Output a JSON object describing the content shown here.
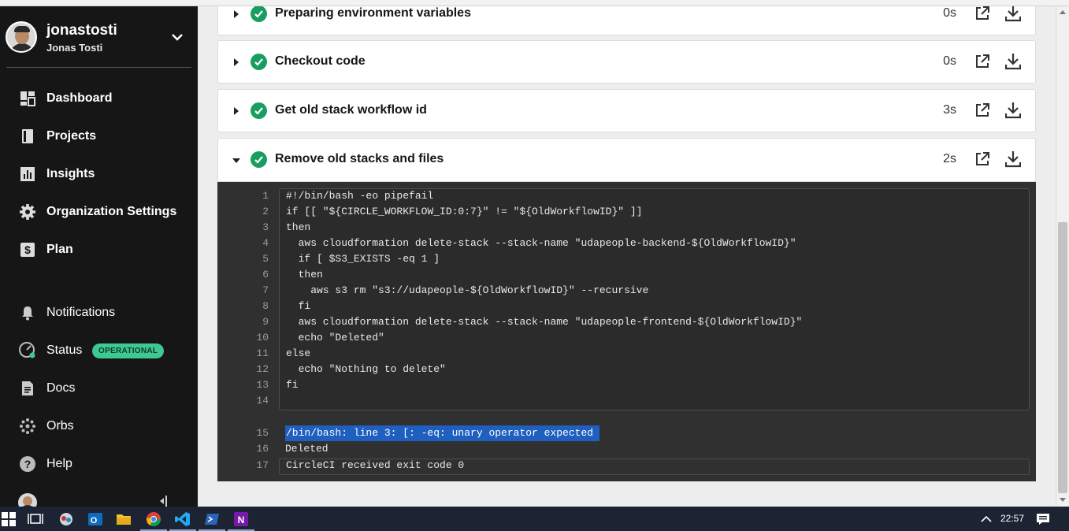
{
  "user": {
    "username": "jonastosti",
    "full_name": "Jonas Tosti"
  },
  "nav": {
    "dashboard": "Dashboard",
    "projects": "Projects",
    "insights": "Insights",
    "org_settings": "Organization Settings",
    "plan": "Plan",
    "notifications": "Notifications",
    "status": "Status",
    "status_badge": "OPERATIONAL",
    "docs": "Docs",
    "orbs": "Orbs",
    "help": "Help"
  },
  "steps": [
    {
      "title": "Preparing environment variables",
      "duration": "0s",
      "expanded": false
    },
    {
      "title": "Checkout code",
      "duration": "0s",
      "expanded": false
    },
    {
      "title": "Get old stack workflow id",
      "duration": "3s",
      "expanded": false
    },
    {
      "title": "Remove old stacks and files",
      "duration": "2s",
      "expanded": true
    }
  ],
  "script_lines": [
    {
      "n": "1",
      "text": "#!/bin/bash -eo pipefail"
    },
    {
      "n": "2",
      "text": "if [[ \"${CIRCLE_WORKFLOW_ID:0:7}\" != \"${OldWorkflowID}\" ]]"
    },
    {
      "n": "3",
      "text": "then"
    },
    {
      "n": "4",
      "text": "  aws cloudformation delete-stack --stack-name \"udapeople-backend-${OldWorkflowID}\""
    },
    {
      "n": "5",
      "text": "  if [ $S3_EXISTS -eq 1 ]"
    },
    {
      "n": "6",
      "text": "  then"
    },
    {
      "n": "7",
      "text": "    aws s3 rm \"s3://udapeople-${OldWorkflowID}\" --recursive"
    },
    {
      "n": "8",
      "text": "  fi"
    },
    {
      "n": "9",
      "text": "  aws cloudformation delete-stack --stack-name \"udapeople-frontend-${OldWorkflowID}\""
    },
    {
      "n": "10",
      "text": "  echo \"Deleted\""
    },
    {
      "n": "11",
      "text": "else"
    },
    {
      "n": "12",
      "text": "  echo \"Nothing to delete\""
    },
    {
      "n": "13",
      "text": "fi"
    },
    {
      "n": "14",
      "text": ""
    }
  ],
  "output_lines": [
    {
      "n": "15",
      "text": "/bin/bash: line 3: [: -eq: unary operator expected",
      "selected": true
    },
    {
      "n": "16",
      "text": "Deleted",
      "selected": false
    },
    {
      "n": "17",
      "text": "CircleCI received exit code 0",
      "selected": false
    }
  ],
  "taskbar": {
    "time": "22:57"
  },
  "colors": {
    "success": "#189f5f",
    "sidebar": "#161616",
    "status_badge": "#3ec993",
    "selection": "#1e5fbf"
  },
  "icons": [
    "dashboard-icon",
    "projects-icon",
    "insights-icon",
    "gear-icon",
    "dollar-icon",
    "bell-icon",
    "gauge-icon",
    "docs-icon",
    "orbs-icon",
    "help-icon",
    "external-link-icon",
    "download-icon",
    "check-icon"
  ]
}
